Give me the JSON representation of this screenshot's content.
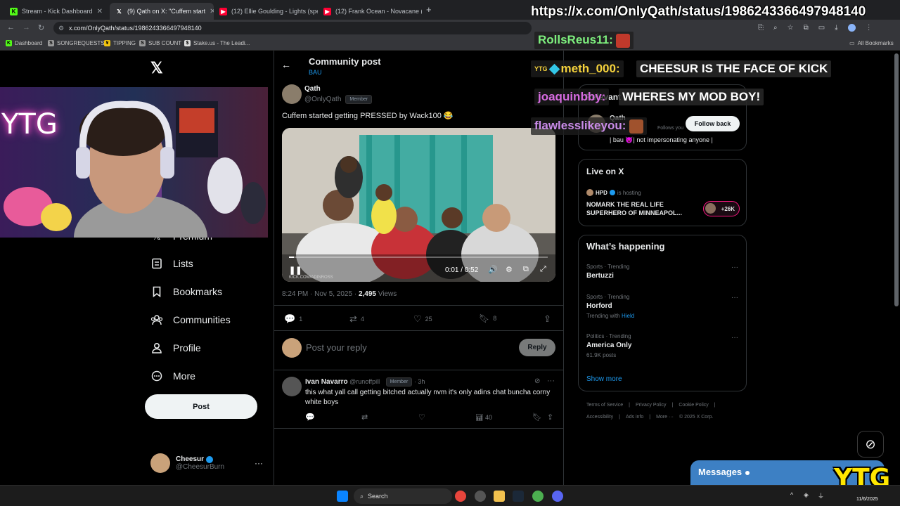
{
  "tabs": [
    {
      "label": "Stream - Kick Dashboard",
      "icon": "kick-icon"
    },
    {
      "label": "(9) Qath on X: \"Cuffem start",
      "icon": "x-icon"
    },
    {
      "label": "(12) Ellie Goulding - Lights (spe",
      "icon": "youtube-icon"
    },
    {
      "label": "(12) Frank Ocean - Novacane (",
      "icon": "youtube-icon"
    }
  ],
  "address": "x.com/OnlyQath/status/1986243366497948140",
  "bookmarks": [
    "Dashboard",
    "SONGREQUESTS",
    "TIPPING",
    "SUB COUNT",
    "Stake.us - The Leadi...",
    "All Bookmarks"
  ],
  "sidebar": {
    "items": [
      {
        "label": "Premium",
        "icon": "x-icon"
      },
      {
        "label": "Lists",
        "icon": "list-icon"
      },
      {
        "label": "Bookmarks",
        "icon": "bookmark-icon"
      },
      {
        "label": "Communities",
        "icon": "communities-icon"
      },
      {
        "label": "Profile",
        "icon": "profile-icon"
      },
      {
        "label": "More",
        "icon": "more-icon"
      }
    ],
    "post_label": "Post",
    "account": {
      "name": "Cheesur",
      "handle": "@CheesurBurn"
    }
  },
  "header": {
    "title": "Community post",
    "subtitle": "BAU"
  },
  "post": {
    "author": "Qath",
    "handle": "@OnlyQath",
    "badge": "Member",
    "text": "Cuffem started getting PRESSED by Wack100 😂",
    "video_time": "0:01 / 0:52",
    "video_progress": 0.02,
    "watermark": "KICK.COM/ADINROSS",
    "time": "8:24 PM · Nov 5, 2025 · ",
    "views_count": "2,495",
    "views_label": " Views",
    "stats": {
      "replies": "1",
      "reposts": "4",
      "likes": "25",
      "bookmarks": "8"
    }
  },
  "reply_box": {
    "placeholder": "Post your reply",
    "button": "Reply"
  },
  "reply": {
    "name": "Ivan Navarro",
    "handle": "@runoffpill",
    "badge": "Member",
    "age": "· 3h",
    "text": "this what yall call getting bitched actually nvm it's only adins chat buncha corny white boys",
    "views": "40"
  },
  "relevant": {
    "title": "Relevant",
    "name": "Qath",
    "follows": "Follows you",
    "follow_button": "Follow back",
    "bio": "| bau 😈| not impersonating anyone |"
  },
  "live": {
    "title": "Live on X",
    "host": "HPD",
    "hosting": "is hosting",
    "headline": "NOMARK THE REAL LIFE SUPERHERO OF MINNEAPOL...",
    "count": "+26K"
  },
  "happening": {
    "title": "What’s happening",
    "trends": [
      {
        "label": "Sports · Trending",
        "topic": "Bertuzzi",
        "extra": ""
      },
      {
        "label": "Sports · Trending",
        "topic": "Horford",
        "extra_prefix": "Trending with ",
        "extra": "Hield"
      },
      {
        "label": "Politics · Trending",
        "topic": "America Only",
        "extra": "61.9K posts"
      }
    ],
    "show_more": "Show more"
  },
  "footer": {
    "line1": [
      "Terms of Service",
      "|",
      "Privacy Policy",
      "|",
      "Cookie Policy",
      "|"
    ],
    "line2": [
      "Accessibility",
      "|",
      "Ads info",
      "|",
      "More ···",
      "© 2025 X Corp."
    ]
  },
  "messages_label": "Messages",
  "overlay": {
    "url": "https://x.com/OnlyQath/status/1986243366497948140",
    "chat": [
      {
        "user": "RollsReus11:",
        "color": "#7ef07e",
        "msg": ""
      },
      {
        "user": "meth_000:",
        "color": "#f5d23c",
        "msg": "CHEESUR IS THE FACE OF KICK",
        "badge": "YTG"
      },
      {
        "user": "joaquinbby:",
        "color": "#d66be0",
        "msg": "WHERES MY MOD BOY!"
      },
      {
        "user": "flawlesslikeyou:",
        "color": "#c98be8",
        "msg": ""
      }
    ],
    "neon": "YTG",
    "logo": "YTG"
  },
  "taskbar": {
    "search": "Search",
    "date": "11/6/2025"
  }
}
